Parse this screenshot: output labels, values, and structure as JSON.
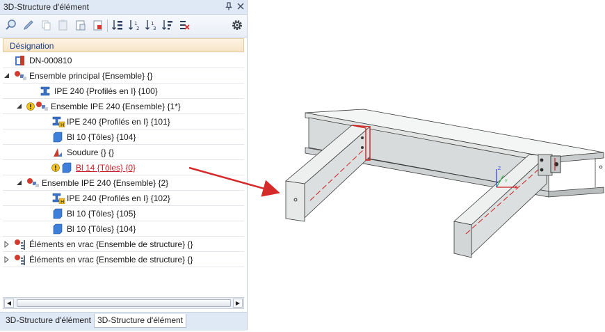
{
  "panel": {
    "title": "3D-Structure d'élément",
    "pin_icon": "pin-icon",
    "close_icon": "close-icon"
  },
  "toolbar": {
    "icons": [
      "zoom-icon",
      "edit-icon",
      "copy-icon",
      "paste-icon",
      "paste-special-icon",
      "paste-into-icon",
      "sort-icon",
      "sort-by-number-1-icon",
      "sort-by-number-2-icon",
      "sort-by-number-3-icon",
      "clear-filter-icon",
      "settings-icon"
    ]
  },
  "column_header": "Désignation",
  "tree": [
    {
      "label": "DN-000810",
      "icon": "drawing-icon",
      "indent": 0,
      "expander": "none",
      "warn": false,
      "error": false
    },
    {
      "label": "Ensemble principal {Ensemble} {}",
      "icon": "assembly-icon",
      "indent": 0,
      "expander": "expanded",
      "warn": false,
      "error": false
    },
    {
      "label": "IPE 240 {Profilés en I} {100}",
      "icon": "i-beam-icon",
      "indent": 2,
      "expander": "none",
      "warn": false,
      "error": false
    },
    {
      "label": "Ensemble IPE 240 {Ensemble} {1*}",
      "icon": "assembly-icon",
      "indent": 1,
      "expander": "expanded",
      "warn": true,
      "error": false
    },
    {
      "label": "IPE 240 {Profilés en I} {101}",
      "icon": "i-beam-main-icon",
      "indent": 3,
      "expander": "none",
      "warn": false,
      "error": false
    },
    {
      "label": "Bl 10 {Tôles} {104}",
      "icon": "plate-icon",
      "indent": 3,
      "expander": "none",
      "warn": false,
      "error": false
    },
    {
      "label": "Soudure {} {}",
      "icon": "weld-icon",
      "indent": 3,
      "expander": "none",
      "warn": false,
      "error": false
    },
    {
      "label": "Bl 14 {Tôles} {0}",
      "icon": "plate-icon",
      "indent": 3,
      "expander": "none",
      "warn": true,
      "error": true
    },
    {
      "label": "Ensemble IPE 240 {Ensemble} {2}",
      "icon": "assembly-icon",
      "indent": 1,
      "expander": "expanded",
      "warn": false,
      "error": false
    },
    {
      "label": "IPE 240 {Profilés en I} {102}",
      "icon": "i-beam-main-icon",
      "indent": 3,
      "expander": "none",
      "warn": false,
      "error": false
    },
    {
      "label": "Bl 10 {Tôles} {105}",
      "icon": "plate-icon",
      "indent": 3,
      "expander": "none",
      "warn": false,
      "error": false
    },
    {
      "label": "Bl 10 {Tôles} {104}",
      "icon": "plate-icon",
      "indent": 3,
      "expander": "none",
      "warn": false,
      "error": false
    },
    {
      "label": "Éléments en vrac {Ensemble de structure} {}",
      "icon": "structure-assembly-icon",
      "indent": 0,
      "expander": "collapsed",
      "warn": false,
      "error": false
    },
    {
      "label": "Éléments en vrac {Ensemble de structure} {}",
      "icon": "structure-assembly-icon",
      "indent": 0,
      "expander": "collapsed",
      "warn": false,
      "error": false
    }
  ],
  "tabs": [
    "3D-Structure d'élément",
    "3D-Structure d'élément"
  ],
  "active_tab": 1,
  "viewport": {
    "axis_labels": [
      "Z",
      "Y",
      "X"
    ],
    "colors": {
      "steel_light": "#eef0f0",
      "steel_mid": "#d9dcdc",
      "steel_dark": "#a9adad",
      "edge": "#3a3a3a",
      "highlight": "#cc1f1f",
      "arrow": "#d42a2a",
      "axis_x": "#d11f1f",
      "axis_y": "#1fae3c",
      "axis_z": "#2a3fd6"
    }
  }
}
